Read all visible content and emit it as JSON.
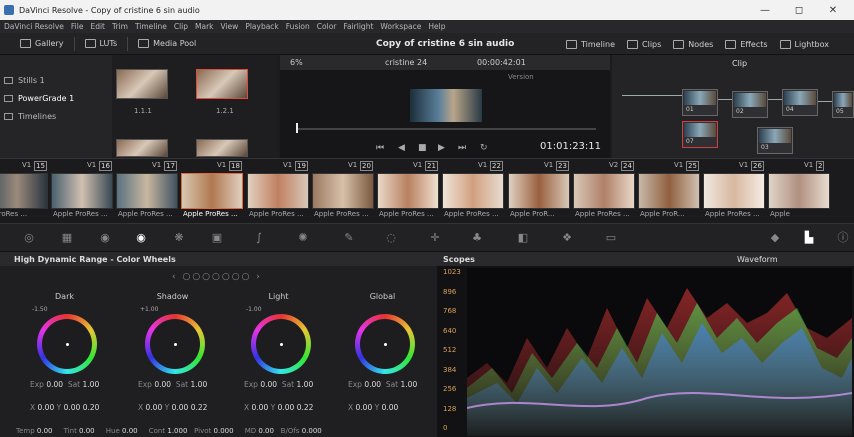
{
  "titlebar": {
    "title": "DaVinci Resolve - Copy of cristine 6 sin audio",
    "minimize": "—",
    "maximize": "◻",
    "close": "✕"
  },
  "menubar": [
    "DaVinci Resolve",
    "File",
    "Edit",
    "Trim",
    "Timeline",
    "Clip",
    "Mark",
    "View",
    "Playback",
    "Fusion",
    "Color",
    "Fairlight",
    "Workspace",
    "Help"
  ],
  "toolbar": {
    "gallery": "Gallery",
    "luts": "LUTs",
    "media_pool": "Media Pool",
    "project_title": "Copy of cristine 6 sin audio",
    "timeline": "Timeline",
    "clips": "Clips",
    "nodes": "Nodes",
    "effects": "Effects",
    "lightbox": "Lightbox"
  },
  "left_panel": {
    "items": [
      "Stills 1",
      "PowerGrade 1",
      "Timelines"
    ]
  },
  "gallery": {
    "labels": [
      "1.1.1",
      "1.2.1"
    ]
  },
  "viewer": {
    "zoom": "6%",
    "timeline_name": "cristine 24",
    "timecode_top": "00:00:42:01",
    "version": "Version",
    "timecode": "01:01:23:11"
  },
  "nodes_panel": {
    "mode": "Clip",
    "labels": [
      "01",
      "02",
      "04",
      "05",
      "07",
      "03"
    ]
  },
  "clips": [
    {
      "v": "V1",
      "n": "15",
      "name": "e ProRes ..."
    },
    {
      "v": "V1",
      "n": "16",
      "name": "Apple ProRes ..."
    },
    {
      "v": "V1",
      "n": "17",
      "name": "Apple ProRes ..."
    },
    {
      "v": "V1",
      "n": "18",
      "name": "Apple ProRes ..."
    },
    {
      "v": "V1",
      "n": "19",
      "name": "Apple ProRes ..."
    },
    {
      "v": "V1",
      "n": "20",
      "name": "Apple ProRes ..."
    },
    {
      "v": "V1",
      "n": "21",
      "name": "Apple ProRes ..."
    },
    {
      "v": "V1",
      "n": "22",
      "name": "Apple ProRes ..."
    },
    {
      "v": "V1",
      "n": "23",
      "name": "Apple ProR..."
    },
    {
      "v": "V2",
      "n": "24",
      "name": "Apple ProRes ..."
    },
    {
      "v": "V1",
      "n": "25",
      "name": "Apple ProR..."
    },
    {
      "v": "V1",
      "n": "26",
      "name": "Apple ProRes ..."
    },
    {
      "v": "V1",
      "n": "2",
      "name": "Apple"
    }
  ],
  "color_wheels": {
    "title": "High Dynamic Range - Color Wheels",
    "wheels": [
      {
        "name": "Dark",
        "small": "-1.50",
        "exp": "0.00",
        "sat": "1.00",
        "x": "0.00",
        "y": "0.00",
        "z": "0.20"
      },
      {
        "name": "Shadow",
        "small": "+1.00",
        "exp": "0.00",
        "sat": "1.00",
        "x": "0.00",
        "y": "0.00",
        "z": "0.22"
      },
      {
        "name": "Light",
        "small": "-1.00",
        "exp": "0.00",
        "sat": "1.00",
        "x": "0.00",
        "y": "0.00",
        "z": "0.22"
      },
      {
        "name": "Global",
        "small": "",
        "exp": "0.00",
        "sat": "1.00",
        "x": "0.00",
        "y": "0.00",
        "z": ""
      }
    ],
    "labels": {
      "exp": "Exp",
      "sat": "Sat",
      "x": "X",
      "y": "Y"
    },
    "bottom": {
      "temp_l": "Temp",
      "temp": "0.00",
      "tint_l": "Tint",
      "tint": "0.00",
      "hue_l": "Hue",
      "hue": "0.00",
      "cont_l": "Cont",
      "cont": "1.000",
      "pivot_l": "Pivot",
      "pivot": "0.000",
      "md_l": "MD",
      "md": "0.00",
      "bofs_l": "B/Ofs",
      "bofs": "0.000"
    }
  },
  "scopes": {
    "title": "Scopes",
    "mode": "Waveform",
    "ticks": [
      "1023",
      "896",
      "768",
      "640",
      "512",
      "384",
      "256",
      "128",
      "0"
    ]
  }
}
